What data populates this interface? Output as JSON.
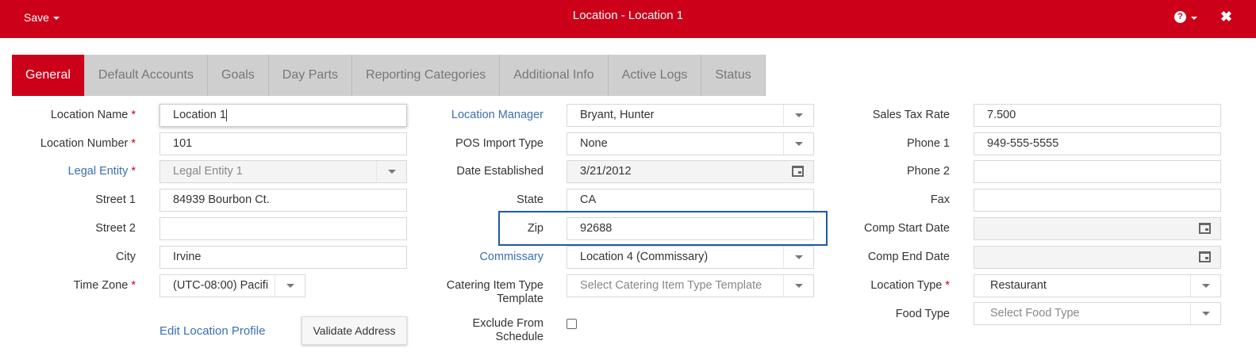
{
  "topbar": {
    "save_label": "Save",
    "title": "Location - Location 1",
    "help_symbol": "?",
    "close_symbol": "✖"
  },
  "tabs": [
    {
      "label": "General",
      "active": true
    },
    {
      "label": "Default Accounts"
    },
    {
      "label": "Goals"
    },
    {
      "label": "Day Parts"
    },
    {
      "label": "Reporting Categories"
    },
    {
      "label": "Additional Info"
    },
    {
      "label": "Active Logs"
    },
    {
      "label": "Status"
    }
  ],
  "col1": {
    "location_name": {
      "label": "Location Name",
      "value": "Location 1"
    },
    "location_number": {
      "label": "Location Number",
      "value": "101"
    },
    "legal_entity": {
      "label": "Legal Entity",
      "value": "Legal Entity 1"
    },
    "street1": {
      "label": "Street 1",
      "value": "84939 Bourbon Ct."
    },
    "street2": {
      "label": "Street 2",
      "value": ""
    },
    "city": {
      "label": "City",
      "value": "Irvine"
    },
    "time_zone": {
      "label": "Time Zone",
      "value": "(UTC-08:00) Pacifi"
    },
    "edit_profile": "Edit Location Profile",
    "validate": "Validate Address",
    "required_mark": "*"
  },
  "col2": {
    "location_manager": {
      "label": "Location Manager",
      "value": "Bryant, Hunter"
    },
    "pos_import_type": {
      "label": "POS Import Type",
      "value": "None"
    },
    "date_established": {
      "label": "Date Established",
      "value": "3/21/2012"
    },
    "state": {
      "label": "State",
      "value": "CA"
    },
    "zip": {
      "label": "Zip",
      "value": "92688"
    },
    "commissary": {
      "label": "Commissary",
      "value": "Location 4 (Commissary)"
    },
    "catering_template": {
      "label_line1": "Catering Item Type",
      "label_line2": "Template",
      "placeholder": "Select Catering Item Type Template"
    },
    "exclude_schedule": {
      "label_line1": "Exclude From",
      "label_line2": "Schedule",
      "checked": false
    }
  },
  "col3": {
    "sales_tax_rate": {
      "label": "Sales Tax Rate",
      "value": "7.500"
    },
    "phone1": {
      "label": "Phone 1",
      "value": "949-555-5555"
    },
    "phone2": {
      "label": "Phone 2",
      "value": ""
    },
    "fax": {
      "label": "Fax",
      "value": ""
    },
    "comp_start_date": {
      "label": "Comp Start Date",
      "value": ""
    },
    "comp_end_date": {
      "label": "Comp End Date",
      "value": ""
    },
    "location_type": {
      "label": "Location Type",
      "value": "Restaurant"
    },
    "food_type": {
      "label": "Food Type",
      "placeholder": "Select Food Type"
    }
  },
  "colors": {
    "brand_red": "#cc0018",
    "link_blue": "#3a6fb0",
    "highlight_border": "#1f5a9c"
  },
  "icons": {
    "calendar": "calendar-icon",
    "dropdown": "chevron-down-icon",
    "help": "help-icon",
    "close": "close-icon"
  }
}
